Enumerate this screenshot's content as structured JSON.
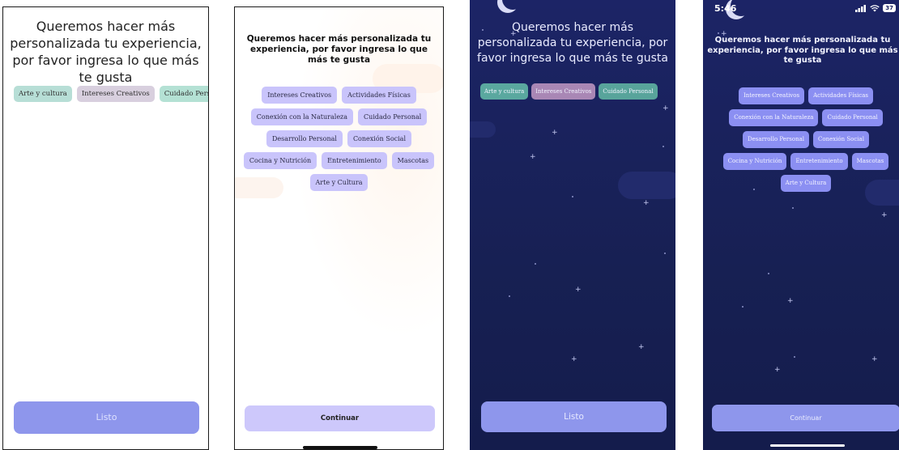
{
  "screens": [
    {
      "title": "Queremos hacer más personalizada tu experiencia, por favor ingresa lo que más te gusta",
      "chips": [
        {
          "label": "Arte y cultura",
          "color": "#b7ded6"
        },
        {
          "label": "Intereses Creativos",
          "color": "#d8cfde"
        },
        {
          "label": "Cuidado Personal",
          "color": "#b4e1d4"
        }
      ],
      "button": "Listo"
    },
    {
      "title": "Queremos hacer más personalizada tu experiencia, por favor ingresa lo que más te gusta",
      "chips": [
        {
          "label": "Intereses Creativos"
        },
        {
          "label": "Actividades Físicas"
        },
        {
          "label": "Conexión con la Naturaleza"
        },
        {
          "label": "Cuidado Personal"
        },
        {
          "label": "Desarrollo Personal"
        },
        {
          "label": "Conexión Social"
        },
        {
          "label": "Cocina y Nutrición"
        },
        {
          "label": "Entretenimiento"
        },
        {
          "label": "Mascotas"
        },
        {
          "label": "Arte y Cultura"
        }
      ],
      "button": "Continuar"
    },
    {
      "title": "Queremos hacer más personalizada tu experiencia, por favor ingresa lo que más te gusta",
      "chips": [
        {
          "label": "Arte y cultura",
          "color": "#5aa89f"
        },
        {
          "label": "Intereses Creativos",
          "color": "#a987b5"
        },
        {
          "label": "Cuidado Personal",
          "color": "#58a49b"
        }
      ],
      "button": "Listo"
    },
    {
      "status_time": "5:46",
      "battery": "37",
      "title": "Queremos hacer más personalizada tu experiencia, por favor ingresa lo que más te gusta",
      "chips": [
        {
          "label": "Intereses Creativos"
        },
        {
          "label": "Actividades Físicas"
        },
        {
          "label": "Conexión con la Naturaleza"
        },
        {
          "label": "Cuidado Personal"
        },
        {
          "label": "Desarrollo Personal"
        },
        {
          "label": "Conexión Social"
        },
        {
          "label": "Cocina y Nutrición"
        },
        {
          "label": "Entretenimiento"
        },
        {
          "label": "Mascotas"
        },
        {
          "label": "Arte y Cultura"
        }
      ],
      "button": "Continuar"
    }
  ],
  "colors": {
    "night_bg": "#1a225e",
    "accent_button": "#8e96ec",
    "light_chip": "#c9c4fb",
    "dark_chip": "#8b8ff2"
  }
}
